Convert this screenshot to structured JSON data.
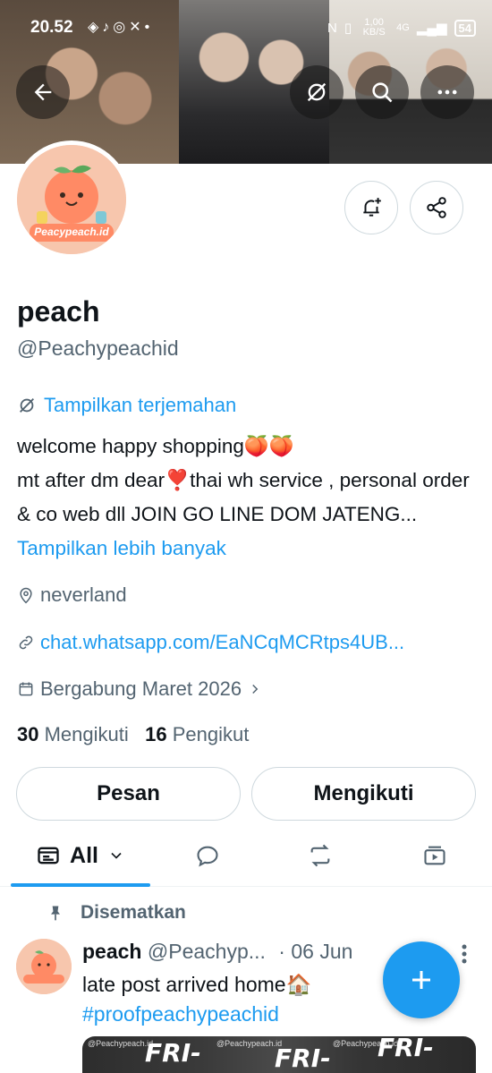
{
  "status_bar": {
    "time": "20.52",
    "speed": "1,00 KB/S",
    "network": "4G",
    "battery": "54"
  },
  "header": {
    "back_icon": "arrow-left-icon",
    "translate_icon": "translate-off-icon",
    "search_icon": "search-icon",
    "more_icon": "more-horizontal-icon"
  },
  "profile": {
    "avatar_text": "Peacypeach.id",
    "name": "peach",
    "handle": "@Peachypeachid",
    "translate_label": "Tampilkan terjemahan",
    "bio_line1": "welcome happy shopping🍑🍑",
    "bio_line2": "mt after dm dear❣️thai wh service , personal order & co web dll JOIN GO LINE DOM JATENG...",
    "show_more": "Tampilkan lebih banyak",
    "location": "neverland",
    "link": "chat.whatsapp.com/EaNCqMCRtps4UB...",
    "joined": "Bergabung Maret 2026",
    "following_count": "30",
    "following_label": "Mengikuti",
    "followers_count": "16",
    "followers_label": "Pengikut"
  },
  "actions": {
    "message_label": "Pesan",
    "following_button_label": "Mengikuti"
  },
  "tabs": {
    "all_label": "All"
  },
  "pinned_post": {
    "pinned_label": "Disematkan",
    "author_name": "peach",
    "author_handle": "@Peachyp...",
    "date": "· 06 Jun",
    "text": "late post arrived home🏠",
    "hashtag": "#proofpeachypeachid",
    "image_words": [
      "FRI-",
      "FRI-",
      "FRI-"
    ],
    "image_watermark": "@Peachypeach.id"
  },
  "colors": {
    "accent": "#1d9bf0",
    "text_primary": "#0f1419",
    "text_secondary": "#536471",
    "border": "#cfd9de"
  }
}
